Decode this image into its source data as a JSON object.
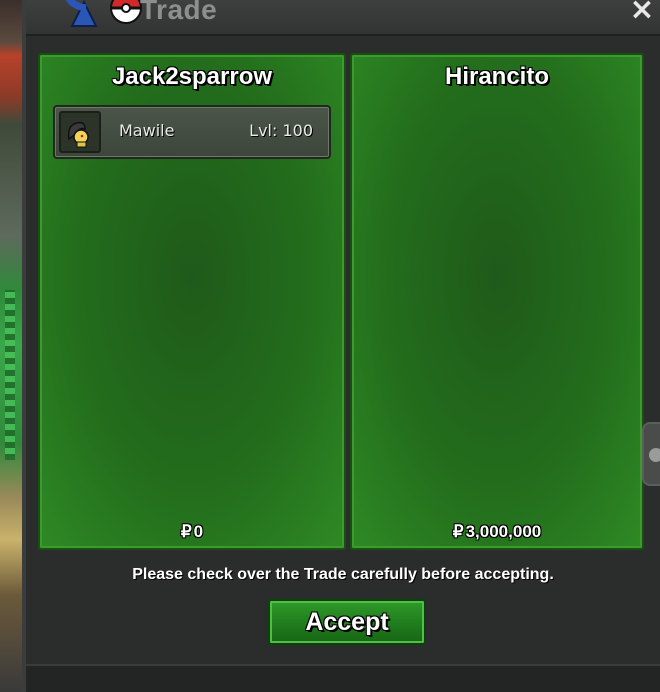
{
  "window": {
    "title": "Trade",
    "close_label": "×"
  },
  "trade": {
    "left": {
      "trainer": "Jack2sparrow",
      "pokemon": [
        {
          "name": "Mawile",
          "level": "Lvl: 100",
          "sprite_icon": "mawile-sprite-icon"
        }
      ],
      "currency_symbol": "₽",
      "money": "0"
    },
    "right": {
      "trainer": "Hirancito",
      "pokemon": [],
      "currency_symbol": "₽",
      "money": "3,000,000"
    }
  },
  "notice": "Please check over the Trade carefully before accepting.",
  "accept_label": "Accept",
  "colors": {
    "panel_green": "#236d1c",
    "button_green": "#1f7a1c",
    "window_bg": "#2b2d2c"
  }
}
